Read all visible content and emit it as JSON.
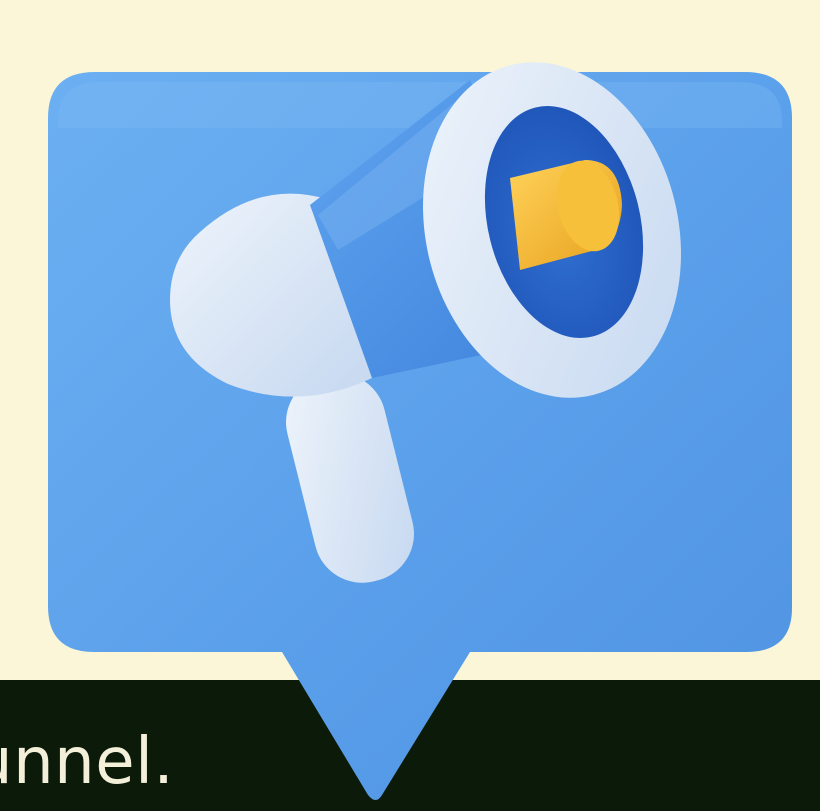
{
  "caption": {
    "text": "unnel."
  },
  "illustration": {
    "icon": "megaphone-icon",
    "bubble_icon": "speech-bubble-icon"
  },
  "colors": {
    "background": "#fbf6d8",
    "band": "#0c1a0a",
    "bubble": "#5aa0ea",
    "megaphone_body": "#4a8fe6",
    "megaphone_light": "#d9e6f6",
    "accent_yellow": "#f3b62c",
    "caption_text": "#f3efd9"
  }
}
